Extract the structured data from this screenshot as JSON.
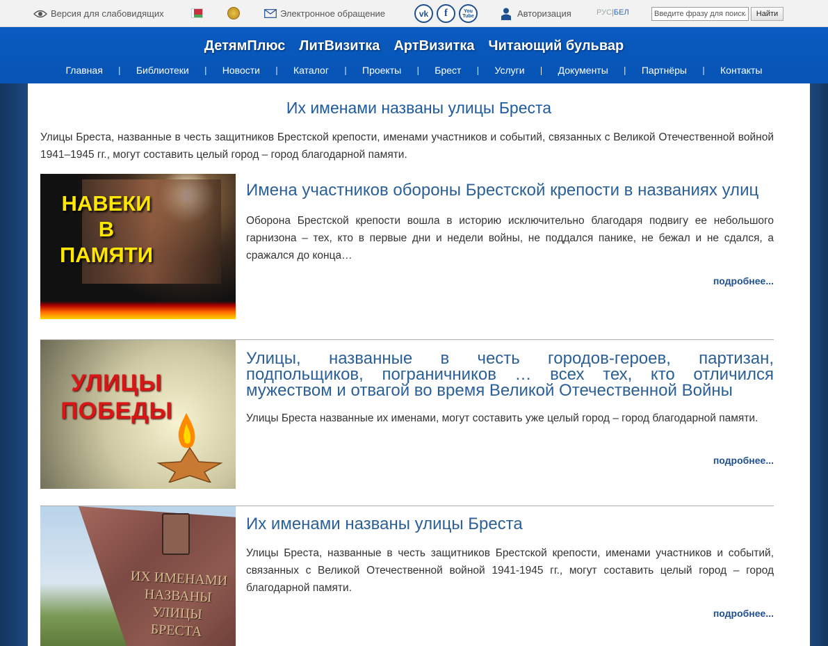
{
  "topbar": {
    "accessibility": "Версия для слабовидящих",
    "appeal": "Электронное обращение",
    "social": {
      "vk": "vk",
      "fb": "f",
      "yt": "You Tube"
    },
    "login": "Авторизация",
    "lang_ru": "РУС",
    "lang_sep": "|",
    "lang_be": "БЕЛ",
    "search_placeholder": "Введите фразу для поиска",
    "search_button": "Найти"
  },
  "projects": [
    "ДетямПлюс",
    "ЛитВизитка",
    "АртВизитка",
    "Читающий бульвар"
  ],
  "nav": [
    "Главная",
    "Библиотеки",
    "Новости",
    "Каталог",
    "Проекты",
    "Брест",
    "Услуги",
    "Документы",
    "Партнёры",
    "Контакты"
  ],
  "page": {
    "title": "Их именами названы улицы Бреста",
    "intro": "Улицы Бреста, названные в честь защитников Брестской крепости, именами участников и событий, связанных с Великой Отечественной войной 1941–1945 гг., могут составить целый город – город благодарной памяти."
  },
  "articles": [
    {
      "image_text": [
        "НАВЕКИ",
        "В",
        "ПАМЯТИ"
      ],
      "title": "Имена участников обороны Брестской крепости в названиях улиц",
      "text": "Оборона Брестской крепости вошла в историю исключительно благодаря подвигу ее небольшого гарнизона – тех, кто в первые дни и недели войны, не поддался панике, не бежал и не сдался, а сражался до конца…",
      "more": "подробнее..."
    },
    {
      "image_text": [
        "УЛИЦЫ",
        "ПОБЕДЫ"
      ],
      "title": "Улицы, названные в честь городов-героев, партизан, подпольщиков, пограничников … всех тех, кто отличился мужеством и отвагой во время Великой Отечественной Войны",
      "text": "Улицы Бреста названные их именами, могут составить уже целый город – город благодарной памяти.",
      "more": "подробнее..."
    },
    {
      "image_text": [
        "ИХ ИМЕНАМИ",
        "НАЗВАНЫ",
        "УЛИЦЫ",
        "БРЕСТА"
      ],
      "title": "Их именами названы улицы Бреста",
      "text": "Улицы Бреста, названные в честь защитников Брестской крепости, именами участников и событий, связанных с Великой Отечественной войной 1941-1945 гг., могут составить целый город – город благодарной памяти.",
      "more": "подробнее..."
    }
  ],
  "colors": {
    "header_blue": "#0a5ac0",
    "link_blue": "#1e4f91",
    "title_blue": "#2b5f98"
  }
}
